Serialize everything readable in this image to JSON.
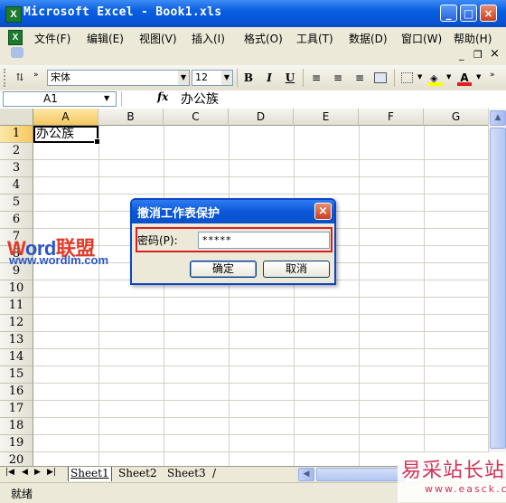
{
  "window": {
    "title": "Microsoft Excel - Book1.xls",
    "icon": "excel-icon",
    "controls": {
      "minimize": "_",
      "maximize": "□",
      "close": "×"
    }
  },
  "menu": {
    "items": [
      "文件(F)",
      "编辑(E)",
      "视图(V)",
      "插入(I)",
      "格式(O)",
      "工具(T)",
      "数据(D)",
      "窗口(W)",
      "帮助(H)"
    ],
    "doc_controls": {
      "minimize": "_",
      "restore": "❐",
      "close": "×"
    }
  },
  "toolbar": {
    "font_name": "宋体",
    "font_size": "12",
    "bold": "B",
    "italic": "I",
    "underline": "U",
    "font_color": "#e02020",
    "fill_color": "#ffff00"
  },
  "formula_bar": {
    "name_box": "A1",
    "fx": "fx",
    "value": "办公族"
  },
  "grid": {
    "columns": [
      "A",
      "B",
      "C",
      "D",
      "E",
      "F",
      "G"
    ],
    "rows": [
      "1",
      "2",
      "3",
      "4",
      "5",
      "6",
      "7",
      "8",
      "9",
      "10",
      "11",
      "12",
      "13",
      "14",
      "15",
      "16",
      "17",
      "18",
      "19",
      "20"
    ],
    "cell_A1": "办公族",
    "selected_cell": "A1"
  },
  "sheets": {
    "tabs": [
      "Sheet1",
      "Sheet2",
      "Sheet3"
    ],
    "active": "Sheet1"
  },
  "status": {
    "text": "就绪"
  },
  "dialog": {
    "title": "撤消工作表保护",
    "password_label": "密码(P):",
    "password_value": "*****",
    "ok_label": "确定",
    "cancel_label": "取消"
  },
  "watermarks": {
    "word_w": "W",
    "word_ord": "ord",
    "word_cn": "联盟",
    "word_url": "www.wordlm.com",
    "site_main": "易采站长站",
    "site_url": "www.easck.com"
  }
}
